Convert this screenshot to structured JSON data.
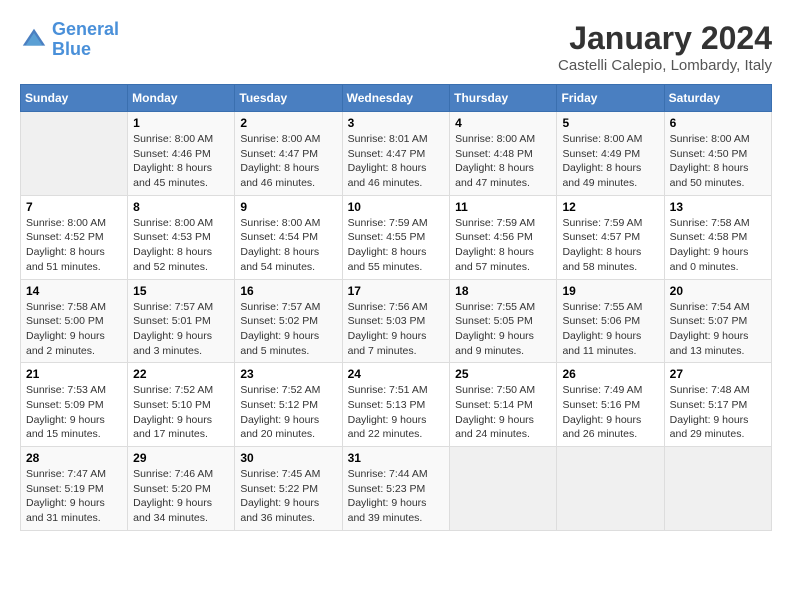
{
  "app": {
    "logo_line1": "General",
    "logo_line2": "Blue"
  },
  "header": {
    "title": "January 2024",
    "subtitle": "Castelli Calepio, Lombardy, Italy"
  },
  "weekdays": [
    "Sunday",
    "Monday",
    "Tuesday",
    "Wednesday",
    "Thursday",
    "Friday",
    "Saturday"
  ],
  "weeks": [
    [
      {
        "day": "",
        "sunrise": "",
        "sunset": "",
        "daylight": ""
      },
      {
        "day": "1",
        "sunrise": "Sunrise: 8:00 AM",
        "sunset": "Sunset: 4:46 PM",
        "daylight": "Daylight: 8 hours and 45 minutes."
      },
      {
        "day": "2",
        "sunrise": "Sunrise: 8:00 AM",
        "sunset": "Sunset: 4:47 PM",
        "daylight": "Daylight: 8 hours and 46 minutes."
      },
      {
        "day": "3",
        "sunrise": "Sunrise: 8:01 AM",
        "sunset": "Sunset: 4:47 PM",
        "daylight": "Daylight: 8 hours and 46 minutes."
      },
      {
        "day": "4",
        "sunrise": "Sunrise: 8:00 AM",
        "sunset": "Sunset: 4:48 PM",
        "daylight": "Daylight: 8 hours and 47 minutes."
      },
      {
        "day": "5",
        "sunrise": "Sunrise: 8:00 AM",
        "sunset": "Sunset: 4:49 PM",
        "daylight": "Daylight: 8 hours and 49 minutes."
      },
      {
        "day": "6",
        "sunrise": "Sunrise: 8:00 AM",
        "sunset": "Sunset: 4:50 PM",
        "daylight": "Daylight: 8 hours and 50 minutes."
      }
    ],
    [
      {
        "day": "7",
        "sunrise": "Sunrise: 8:00 AM",
        "sunset": "Sunset: 4:52 PM",
        "daylight": "Daylight: 8 hours and 51 minutes."
      },
      {
        "day": "8",
        "sunrise": "Sunrise: 8:00 AM",
        "sunset": "Sunset: 4:53 PM",
        "daylight": "Daylight: 8 hours and 52 minutes."
      },
      {
        "day": "9",
        "sunrise": "Sunrise: 8:00 AM",
        "sunset": "Sunset: 4:54 PM",
        "daylight": "Daylight: 8 hours and 54 minutes."
      },
      {
        "day": "10",
        "sunrise": "Sunrise: 7:59 AM",
        "sunset": "Sunset: 4:55 PM",
        "daylight": "Daylight: 8 hours and 55 minutes."
      },
      {
        "day": "11",
        "sunrise": "Sunrise: 7:59 AM",
        "sunset": "Sunset: 4:56 PM",
        "daylight": "Daylight: 8 hours and 57 minutes."
      },
      {
        "day": "12",
        "sunrise": "Sunrise: 7:59 AM",
        "sunset": "Sunset: 4:57 PM",
        "daylight": "Daylight: 8 hours and 58 minutes."
      },
      {
        "day": "13",
        "sunrise": "Sunrise: 7:58 AM",
        "sunset": "Sunset: 4:58 PM",
        "daylight": "Daylight: 9 hours and 0 minutes."
      }
    ],
    [
      {
        "day": "14",
        "sunrise": "Sunrise: 7:58 AM",
        "sunset": "Sunset: 5:00 PM",
        "daylight": "Daylight: 9 hours and 2 minutes."
      },
      {
        "day": "15",
        "sunrise": "Sunrise: 7:57 AM",
        "sunset": "Sunset: 5:01 PM",
        "daylight": "Daylight: 9 hours and 3 minutes."
      },
      {
        "day": "16",
        "sunrise": "Sunrise: 7:57 AM",
        "sunset": "Sunset: 5:02 PM",
        "daylight": "Daylight: 9 hours and 5 minutes."
      },
      {
        "day": "17",
        "sunrise": "Sunrise: 7:56 AM",
        "sunset": "Sunset: 5:03 PM",
        "daylight": "Daylight: 9 hours and 7 minutes."
      },
      {
        "day": "18",
        "sunrise": "Sunrise: 7:55 AM",
        "sunset": "Sunset: 5:05 PM",
        "daylight": "Daylight: 9 hours and 9 minutes."
      },
      {
        "day": "19",
        "sunrise": "Sunrise: 7:55 AM",
        "sunset": "Sunset: 5:06 PM",
        "daylight": "Daylight: 9 hours and 11 minutes."
      },
      {
        "day": "20",
        "sunrise": "Sunrise: 7:54 AM",
        "sunset": "Sunset: 5:07 PM",
        "daylight": "Daylight: 9 hours and 13 minutes."
      }
    ],
    [
      {
        "day": "21",
        "sunrise": "Sunrise: 7:53 AM",
        "sunset": "Sunset: 5:09 PM",
        "daylight": "Daylight: 9 hours and 15 minutes."
      },
      {
        "day": "22",
        "sunrise": "Sunrise: 7:52 AM",
        "sunset": "Sunset: 5:10 PM",
        "daylight": "Daylight: 9 hours and 17 minutes."
      },
      {
        "day": "23",
        "sunrise": "Sunrise: 7:52 AM",
        "sunset": "Sunset: 5:12 PM",
        "daylight": "Daylight: 9 hours and 20 minutes."
      },
      {
        "day": "24",
        "sunrise": "Sunrise: 7:51 AM",
        "sunset": "Sunset: 5:13 PM",
        "daylight": "Daylight: 9 hours and 22 minutes."
      },
      {
        "day": "25",
        "sunrise": "Sunrise: 7:50 AM",
        "sunset": "Sunset: 5:14 PM",
        "daylight": "Daylight: 9 hours and 24 minutes."
      },
      {
        "day": "26",
        "sunrise": "Sunrise: 7:49 AM",
        "sunset": "Sunset: 5:16 PM",
        "daylight": "Daylight: 9 hours and 26 minutes."
      },
      {
        "day": "27",
        "sunrise": "Sunrise: 7:48 AM",
        "sunset": "Sunset: 5:17 PM",
        "daylight": "Daylight: 9 hours and 29 minutes."
      }
    ],
    [
      {
        "day": "28",
        "sunrise": "Sunrise: 7:47 AM",
        "sunset": "Sunset: 5:19 PM",
        "daylight": "Daylight: 9 hours and 31 minutes."
      },
      {
        "day": "29",
        "sunrise": "Sunrise: 7:46 AM",
        "sunset": "Sunset: 5:20 PM",
        "daylight": "Daylight: 9 hours and 34 minutes."
      },
      {
        "day": "30",
        "sunrise": "Sunrise: 7:45 AM",
        "sunset": "Sunset: 5:22 PM",
        "daylight": "Daylight: 9 hours and 36 minutes."
      },
      {
        "day": "31",
        "sunrise": "Sunrise: 7:44 AM",
        "sunset": "Sunset: 5:23 PM",
        "daylight": "Daylight: 9 hours and 39 minutes."
      },
      {
        "day": "",
        "sunrise": "",
        "sunset": "",
        "daylight": ""
      },
      {
        "day": "",
        "sunrise": "",
        "sunset": "",
        "daylight": ""
      },
      {
        "day": "",
        "sunrise": "",
        "sunset": "",
        "daylight": ""
      }
    ]
  ]
}
